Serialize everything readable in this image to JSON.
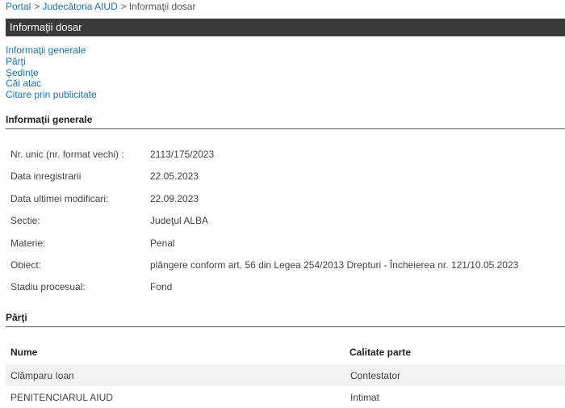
{
  "breadcrumb": {
    "items": [
      "Portal",
      "Judecătoria AIUD"
    ],
    "current": "Informaţii dosar",
    "separator": ">"
  },
  "page_title": "Informaţii dosar",
  "toc": [
    "Informaţii generale",
    "Părţi",
    "Şedinţe",
    "Căi atac",
    "Citare prin publicitate"
  ],
  "general": {
    "heading": "Informaţii generale",
    "rows": [
      {
        "label": "Nr. unic (nr. format vechi) :",
        "value": "2113/175/2023"
      },
      {
        "label": "Data inregistrarii",
        "value": "22.05.2023"
      },
      {
        "label": "Data ultimei modificari:",
        "value": "22.09.2023"
      },
      {
        "label": "Sectie:",
        "value": "Judeţul ALBA"
      },
      {
        "label": "Materie:",
        "value": "Penal"
      },
      {
        "label": "Obiect:",
        "value": "plângere conform art. 56 din Legea 254/2013 Drepturi - Încheierea nr. 121/10.05.2023"
      },
      {
        "label": "Stadiu procesual:",
        "value": "Fond"
      }
    ]
  },
  "parties": {
    "heading": "Părţi",
    "columns": [
      "Nume",
      "Calitate parte"
    ],
    "rows": [
      {
        "name": "Clămparu Ioan",
        "role": "Contestator"
      },
      {
        "name": "PENITENCIARUL AIUD",
        "role": "Intimat"
      }
    ]
  },
  "colors": {
    "link": "#1f6fa8",
    "title_bar": "#3a3a3a",
    "row_alt": "#f2f2f2"
  }
}
